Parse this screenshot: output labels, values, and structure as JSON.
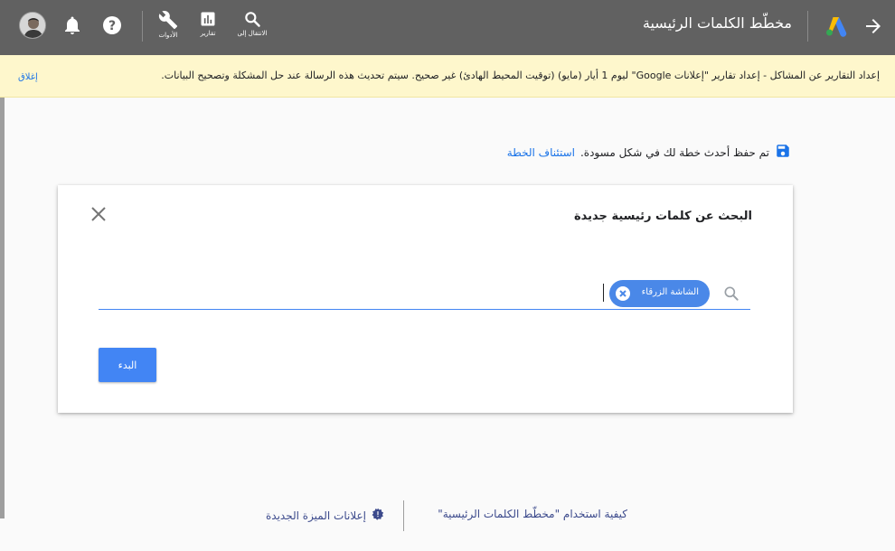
{
  "header": {
    "title": "مخطّط الكلمات الرئيسية",
    "nav": {
      "goto_label": "الانتقال إلى",
      "reports_label": "تقارير",
      "tools_label": "الأدوات"
    }
  },
  "banner": {
    "message": "إعداد التقارير عن المشاكل - إعداد تقارير \"إعلانات Google\" ليوم 1 أيار (مايو) (توقيت المحيط الهادئ) غير صحيح. سيتم تحديث هذه الرسالة عند حل المشكلة وتصحيح البيانات.",
    "close_label": "إغلاق"
  },
  "saved": {
    "text": "تم حفظ أحدث خطة لك في شكل مسودة.",
    "resume_link": "استئناف الخطة"
  },
  "card": {
    "title": "البحث عن كلمات رئيسية جديدة",
    "chip_label": "الشاشة الزرقاء",
    "start_button": "البدء"
  },
  "footer": {
    "how_to_link": "كيفية استخدام \"مخطّط الكلمات الرئيسية\"",
    "new_features_link": "إعلانات الميزة الجديدة"
  },
  "colors": {
    "header_bg": "#616161",
    "banner_bg": "#fef7cc",
    "accent": "#4285f4",
    "link": "#1a73e8"
  },
  "icons": [
    "arrow-forward-icon",
    "google-ads-logo-icon",
    "search-icon",
    "bar-chart-icon",
    "wrench-icon",
    "help-icon",
    "bell-icon",
    "avatar",
    "save-icon",
    "close-icon",
    "chip-remove-icon",
    "announcement-icon"
  ]
}
